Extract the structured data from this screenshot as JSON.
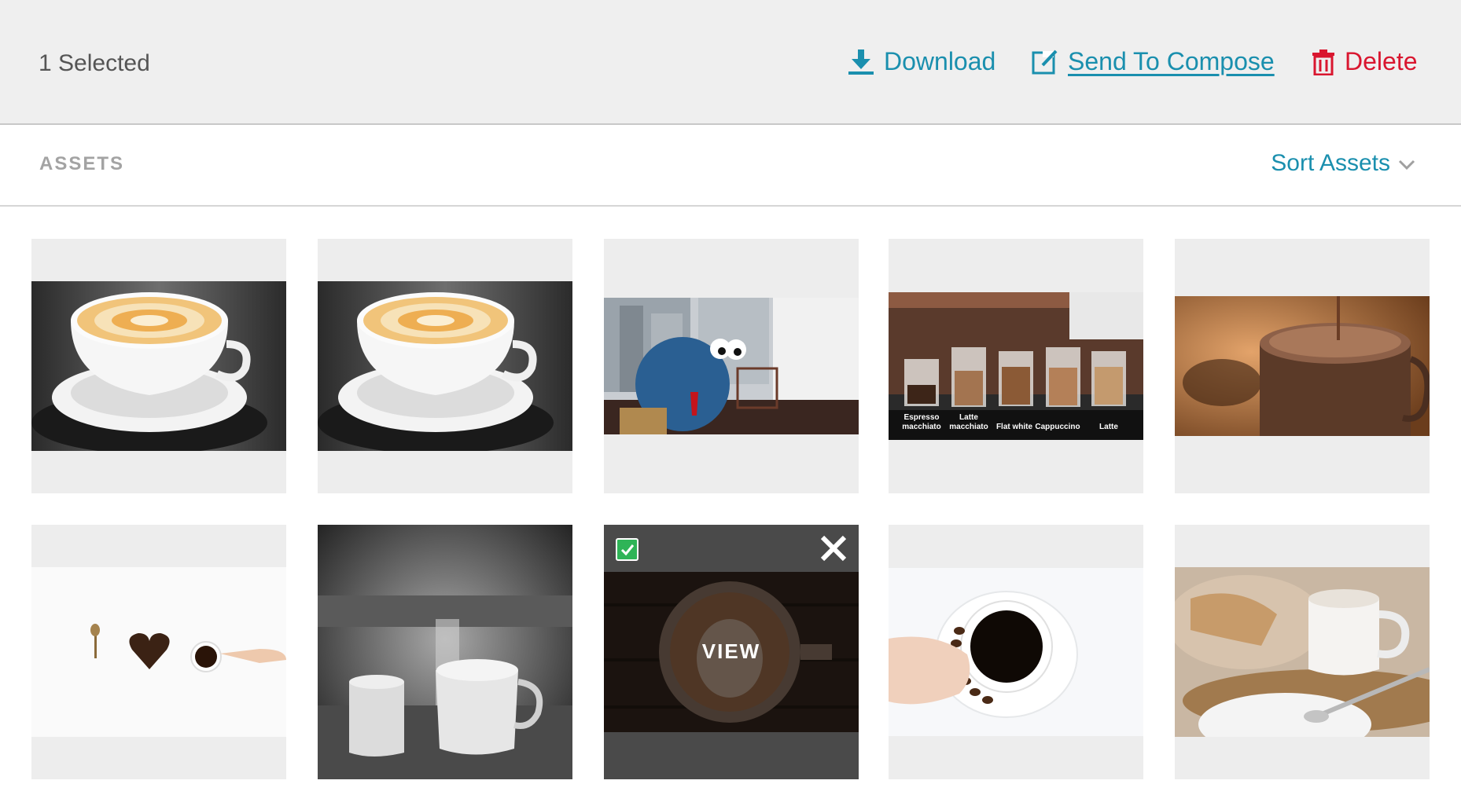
{
  "toolbar": {
    "selected_count": "1 Selected",
    "download_label": "Download",
    "compose_label": "Send To Compose",
    "delete_label": "Delete",
    "download_icon": "download-icon",
    "compose_icon": "edit-icon",
    "delete_icon": "trash-icon"
  },
  "assets_bar": {
    "title": "ASSETS",
    "sort_label": "Sort Assets",
    "sort_icon": "chevron-down-icon"
  },
  "colors": {
    "accent": "#1a8fae",
    "danger": "#d9162f",
    "selected_check": "#2fb457",
    "tile_bg": "#ededed"
  },
  "grid": {
    "tiles": [
      {
        "subject": "latte-cup",
        "selected": false
      },
      {
        "subject": "latte-cup",
        "selected": false
      },
      {
        "subject": "cookie-monster",
        "selected": false
      },
      {
        "subject": "coffee-drinks",
        "selected": false,
        "captions": [
          "Espresso macchiato",
          "Latte macchiato",
          "Flat white",
          "Cappuccino",
          "Latte"
        ]
      },
      {
        "subject": "hot-chocolate",
        "selected": false
      },
      {
        "subject": "coffee-heart",
        "selected": false
      },
      {
        "subject": "cafe-mugs-bw",
        "selected": false
      },
      {
        "subject": "latte-art-top",
        "selected": true,
        "hover_label": "VIEW"
      },
      {
        "subject": "black-coffee-hand",
        "selected": false
      },
      {
        "subject": "mug-and-cake",
        "selected": false
      }
    ]
  }
}
